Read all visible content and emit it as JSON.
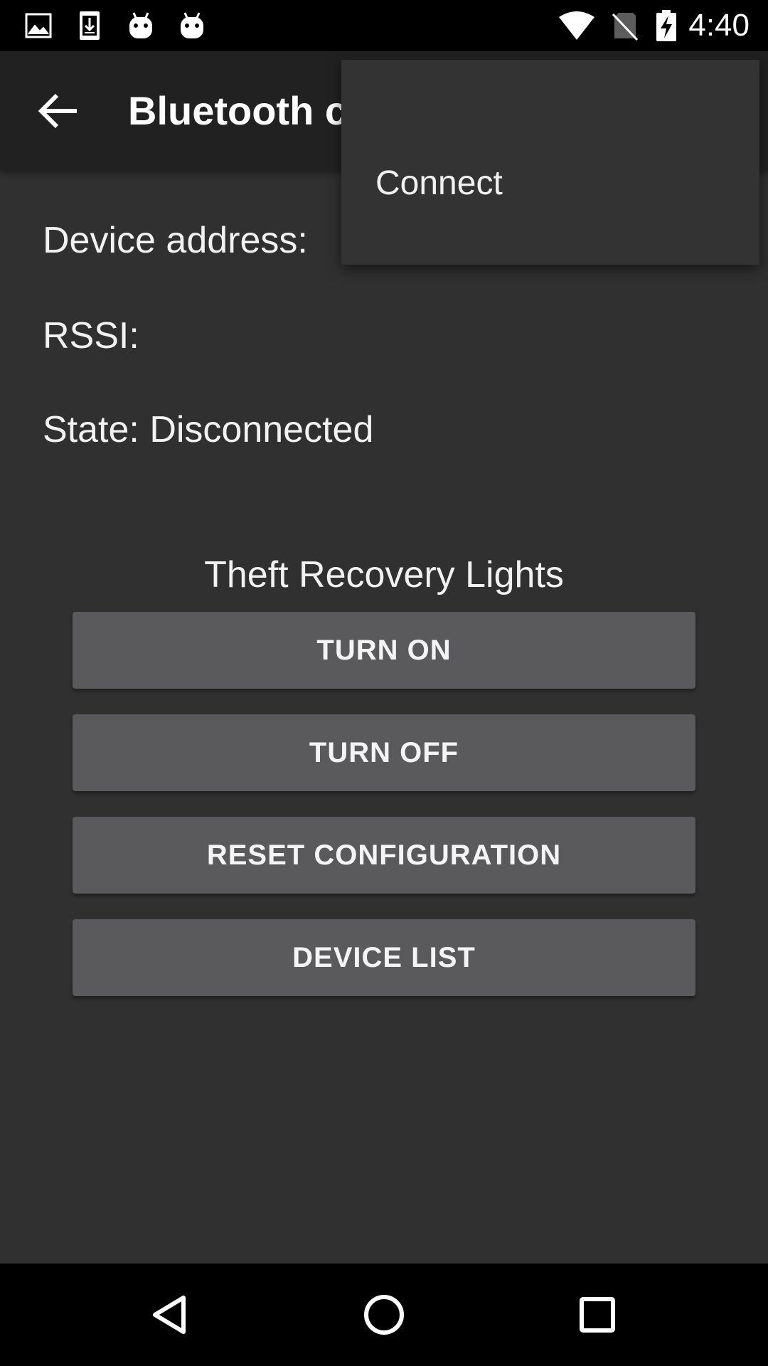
{
  "status_bar": {
    "time": "4:40",
    "left_icons": [
      "image-icon",
      "download-icon",
      "android-icon",
      "android-icon"
    ],
    "right_icons": [
      "wifi-icon",
      "no-sim-icon",
      "battery-charging-icon"
    ]
  },
  "app_bar": {
    "title": "Bluetooth c",
    "back_icon": "arrow-back-icon"
  },
  "device_info": {
    "address_label": "Device address:",
    "rssi_label": "RSSI:",
    "state_label": "State: Disconnected"
  },
  "section": {
    "title": "Theft Recovery Lights"
  },
  "buttons": {
    "turn_on": "TURN ON",
    "turn_off": "TURN OFF",
    "reset_configuration": "RESET CONFIGURATION",
    "device_list": "DEVICE LIST"
  },
  "overflow_menu": {
    "items": [
      {
        "label": ""
      },
      {
        "label": "Connect"
      }
    ]
  },
  "nav_bar": {
    "icons": [
      "back-triangle-icon",
      "home-circle-icon",
      "recents-square-icon"
    ]
  },
  "colors": {
    "background": "#303030",
    "app_bar": "#212121",
    "button": "#5a5a5c",
    "menu": "#333333",
    "system_bars": "#000000"
  }
}
